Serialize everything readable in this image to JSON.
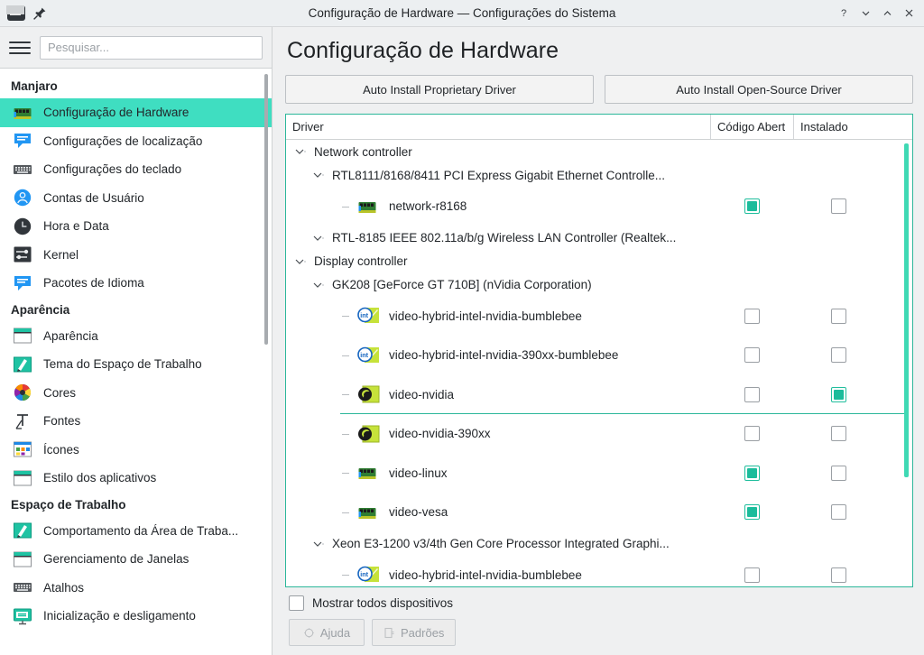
{
  "window": {
    "title": "Configuração de Hardware — Configurações do Sistema",
    "app_icon": "hardware-chip-icon",
    "pin_icon": "pin-icon",
    "controls": [
      {
        "name": "help-button",
        "glyph": "?"
      },
      {
        "name": "minimize-button",
        "glyph": "⌄"
      },
      {
        "name": "maximize-button",
        "glyph": "⌃"
      },
      {
        "name": "close-button",
        "glyph": "✕"
      }
    ]
  },
  "sidebar": {
    "menu_icon": "hamburger-menu-icon",
    "search": {
      "placeholder": "Pesquisar...",
      "value": ""
    },
    "groups": [
      {
        "title": "Manjaro",
        "items": [
          {
            "label": "Configuração de Hardware",
            "icon": "network-card-icon",
            "selected": true
          },
          {
            "label": "Configurações de localização",
            "icon": "speech-bubble-icon",
            "selected": false
          },
          {
            "label": "Configurações do teclado",
            "icon": "keyboard-icon",
            "selected": false
          },
          {
            "label": "Contas de Usuário",
            "icon": "user-circle-icon",
            "selected": false
          },
          {
            "label": "Hora e Data",
            "icon": "clock-icon",
            "selected": false
          },
          {
            "label": "Kernel",
            "icon": "sliders-icon",
            "selected": false
          },
          {
            "label": "Pacotes de Idioma",
            "icon": "speech-bubble-icon",
            "selected": false
          }
        ]
      },
      {
        "title": "Aparência",
        "items": [
          {
            "label": "Aparência",
            "icon": "window-icon",
            "selected": false
          },
          {
            "label": "Tema do Espaço de Trabalho",
            "icon": "theme-brush-icon",
            "selected": false
          },
          {
            "label": "Cores",
            "icon": "color-wheel-icon",
            "selected": false
          },
          {
            "label": "Fontes",
            "icon": "font-t-icon",
            "selected": false
          },
          {
            "label": "Ícones",
            "icon": "icons-grid-icon",
            "selected": false
          },
          {
            "label": "Estilo dos aplicativos",
            "icon": "window-icon",
            "selected": false
          }
        ]
      },
      {
        "title": "Espaço de Trabalho",
        "items": [
          {
            "label": "Comportamento da Área de Traba...",
            "icon": "theme-brush-icon",
            "selected": false
          },
          {
            "label": "Gerenciamento de Janelas",
            "icon": "window-icon",
            "selected": false
          },
          {
            "label": "Atalhos",
            "icon": "keyboard-icon",
            "selected": false
          },
          {
            "label": "Inicialização e desligamento",
            "icon": "monitor-icon",
            "selected": false
          }
        ]
      }
    ]
  },
  "main": {
    "page_title": "Configuração de Hardware",
    "buttons": {
      "proprietary": "Auto Install Proprietary Driver",
      "open_source": "Auto Install Open-Source Driver"
    },
    "tree": {
      "columns": [
        "Driver",
        "Código Abert",
        "Instalado"
      ],
      "rows": [
        {
          "kind": "category",
          "indent": 0,
          "label": "Network controller",
          "expanded": true
        },
        {
          "kind": "device",
          "indent": 1,
          "label": "RTL8111/8168/8411 PCI Express Gigabit Ethernet Controlle...",
          "expanded": true
        },
        {
          "kind": "driver",
          "indent": 2,
          "label": "network-r8168",
          "icon": "network-card-icon",
          "open_source": true,
          "installed": false
        },
        {
          "kind": "device",
          "indent": 1,
          "label": "RTL-8185 IEEE 802.11a/b/g Wireless LAN Controller (Realtek...",
          "expanded": false
        },
        {
          "kind": "category",
          "indent": 0,
          "label": "Display controller",
          "expanded": true
        },
        {
          "kind": "device",
          "indent": 1,
          "label": "GK208 [GeForce GT 710B] (nVidia Corporation)",
          "expanded": true
        },
        {
          "kind": "driver",
          "indent": 2,
          "label": "video-hybrid-intel-nvidia-bumblebee",
          "icon": "intel-nvidia-icon",
          "open_source": false,
          "installed": false
        },
        {
          "kind": "driver",
          "indent": 2,
          "label": "video-hybrid-intel-nvidia-390xx-bumblebee",
          "icon": "intel-nvidia-icon",
          "open_source": false,
          "installed": false
        },
        {
          "kind": "driver",
          "indent": 2,
          "label": "video-nvidia",
          "icon": "nvidia-icon",
          "open_source": false,
          "installed": true,
          "underline": true
        },
        {
          "kind": "driver",
          "indent": 2,
          "label": "video-nvidia-390xx",
          "icon": "nvidia-icon",
          "open_source": false,
          "installed": false
        },
        {
          "kind": "driver",
          "indent": 2,
          "label": "video-linux",
          "icon": "network-card-icon",
          "open_source": true,
          "installed": false
        },
        {
          "kind": "driver",
          "indent": 2,
          "label": "video-vesa",
          "icon": "network-card-icon",
          "open_source": true,
          "installed": false
        },
        {
          "kind": "device",
          "indent": 1,
          "label": "Xeon E3-1200 v3/4th Gen Core Processor Integrated Graphi...",
          "expanded": true
        },
        {
          "kind": "driver",
          "indent": 2,
          "label": "video-hybrid-intel-nvidia-bumblebee",
          "icon": "intel-nvidia-icon",
          "open_source": false,
          "installed": false
        }
      ]
    },
    "footer": {
      "show_all_label": "Mostrar todos dispositivos",
      "show_all_checked": false,
      "help_label": "Ajuda",
      "defaults_label": "Padrões"
    }
  },
  "colors": {
    "accent": "#3fdec1",
    "accent_dark": "#1bbc9b",
    "window_bg": "#eff0f1",
    "panel_bg": "#ffffff"
  }
}
